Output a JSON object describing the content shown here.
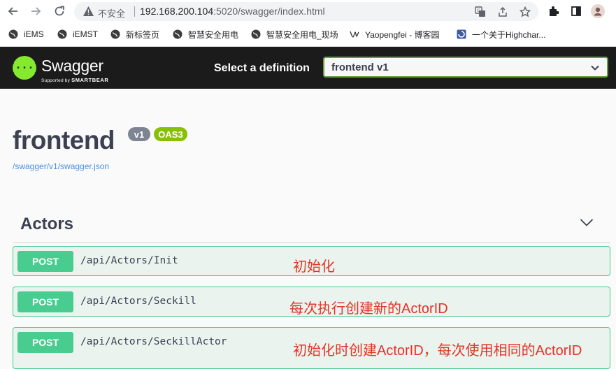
{
  "browser": {
    "security_label": "不安全",
    "url_host": "192.168.200.104",
    "url_rest": ":5020/swagger/index.html"
  },
  "bookmarks": [
    {
      "label": "iEMS"
    },
    {
      "label": "iEMST"
    },
    {
      "label": "新标签页"
    },
    {
      "label": "智慧安全用电"
    },
    {
      "label": "智慧安全用电_现场"
    },
    {
      "label": "Yaopengfei - 博客园"
    },
    {
      "label": "一个关于Highchar..."
    }
  ],
  "topbar": {
    "logo_text": "Swagger",
    "logo_sub_prefix": "Supported by",
    "logo_sub_brand": "SMARTBEAR",
    "definition_label": "Select a definition",
    "definition_value": "frontend v1"
  },
  "info": {
    "title": "frontend",
    "version_badge": "v1",
    "oas_badge": "OAS3",
    "spec_url": "/swagger/v1/swagger.json"
  },
  "tag": {
    "name": "Actors"
  },
  "operations": [
    {
      "method": "POST",
      "path": "/api/Actors/Init",
      "note": "初始化"
    },
    {
      "method": "POST",
      "path": "/api/Actors/Seckill",
      "note": "每次执行创建新的ActorID"
    },
    {
      "method": "POST",
      "path": "/api/Actors/SeckillActor",
      "note": "初始化时创建ActorID，每次使用相同的ActorID"
    }
  ],
  "colors": {
    "topbar_bg": "#1b1b1b",
    "post_green": "#49cc90",
    "post_bg": "#ebf3ef",
    "annotation_red": "#e53325",
    "link_blue": "#4990e2"
  }
}
